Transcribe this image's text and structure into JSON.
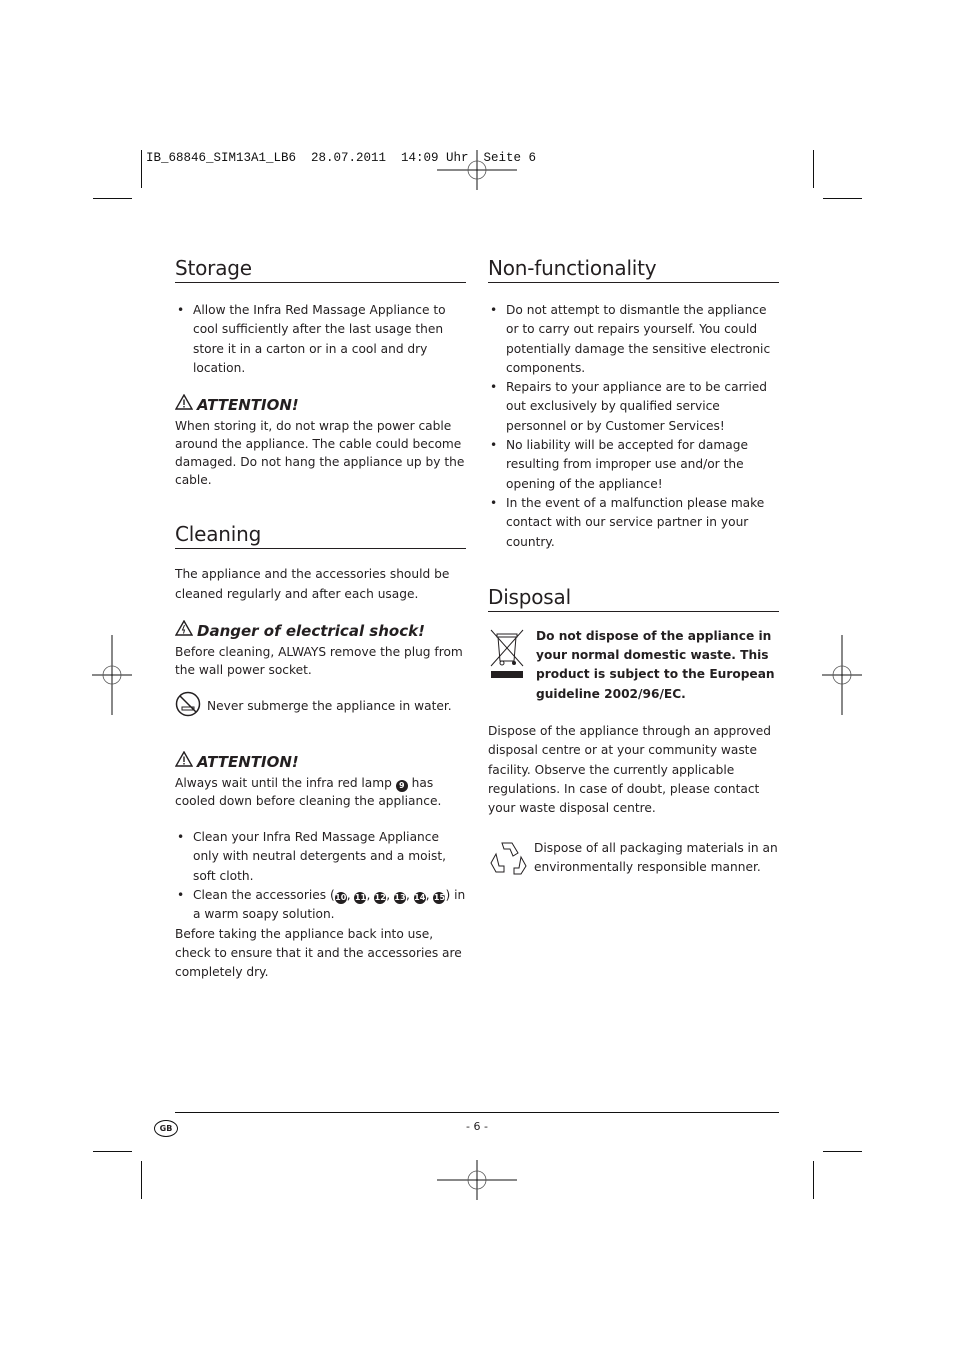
{
  "slug": "IB_68846_SIM13A1_LB6  28.07.2011  14:09 Uhr  Seite 6",
  "storage": {
    "title": "Storage",
    "bullets": [
      "Allow the Infra Red Massage Appliance to cool sufficiently after the last usage then store it in a carton or in a cool and dry location."
    ],
    "attention_label": "ATTENTION!",
    "attention_text": "When storing it, do not wrap the power cable around the appliance. The cable could become damaged. Do not hang the appliance up by the cable."
  },
  "cleaning": {
    "title": "Cleaning",
    "intro": "The appliance and the accessories should be cleaned regularly and after each usage.",
    "danger_label": "Danger of electrical shock!",
    "danger_text": "Before cleaning, ALWAYS remove the plug from the wall power socket.",
    "submerge_text": "Never submerge the appliance in water.",
    "attention_label": "ATTENTION!",
    "attention_text_pre": "Always wait until the infra red lamp",
    "lamp_number": "9",
    "attention_text_post": "has cooled down before cleaning the appliance.",
    "bullet1": "Clean your Infra Red Massage Appliance only with neutral detergents and a moist, soft cloth.",
    "bullet2_pre": "Clean the accessories (",
    "accessory_numbers": [
      "10",
      "11",
      "12",
      "13",
      "14",
      "15"
    ],
    "bullet2_post": ") in a warm soapy solution.",
    "closing": "Before taking the appliance back into use, check to ensure that it and the accessories are completely dry."
  },
  "nonfunctionality": {
    "title": "Non-functionality",
    "bullets": [
      "Do not attempt to dismantle the appliance or to carry out repairs yourself. You could potentially damage the sensitive electronic components.",
      "Repairs to your appliance are to be carried out exclusively by qualified service personnel or by Customer Services!",
      "No liability will be accepted for damage resulting from improper use and/or the opening of the appliance!",
      "In the event of a malfunction please make contact with our service partner in your country."
    ]
  },
  "disposal": {
    "title": "Disposal",
    "weee_text": "Do not dispose of the appliance in your normal domestic waste. This product is subject to the European guideline 2002/96/EC.",
    "body": "Dispose of the appliance through an approved disposal centre or at your community waste facility. Observe the currently applicable regulations. In case of doubt, please contact your waste disposal centre.",
    "recycle_text": "Dispose of all packaging materials in an environmentally responsible manner."
  },
  "footer": {
    "country_badge": "GB",
    "page_number": "- 6 -"
  }
}
